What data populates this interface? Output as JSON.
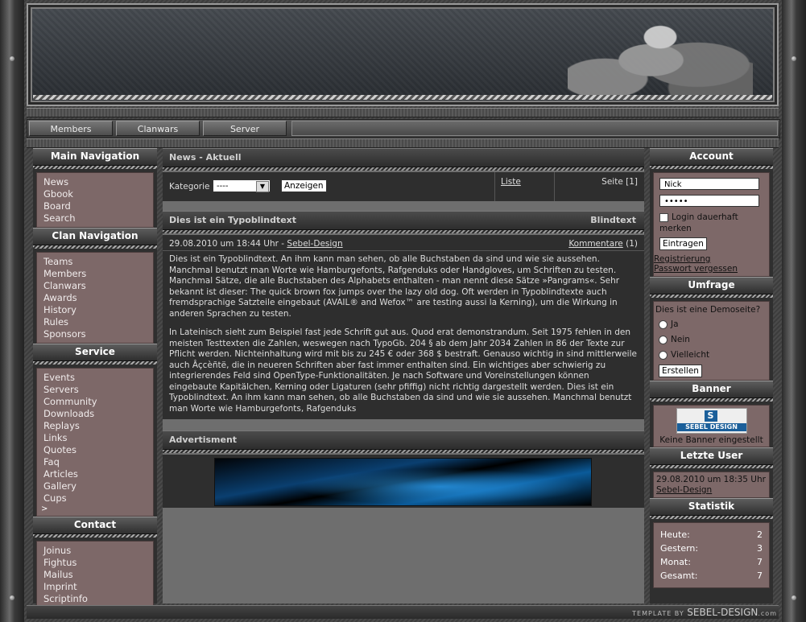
{
  "topnav": [
    "Members",
    "Clanwars",
    "Server"
  ],
  "left": {
    "main_nav": {
      "title": "Main Navigation",
      "items": [
        "News",
        "Gbook",
        "Board",
        "Search"
      ]
    },
    "clan_nav": {
      "title": "Clan Navigation",
      "items": [
        "Teams",
        "Members",
        "Clanwars",
        "Awards",
        "History",
        "Rules",
        "Sponsors"
      ]
    },
    "service": {
      "title": "Service",
      "items": [
        "Events",
        "Servers",
        "Community",
        "Downloads",
        "Replays",
        "Links",
        "Quotes",
        "Faq",
        "Articles",
        "Gallery",
        "Cups"
      ],
      "more": ">"
    },
    "contact": {
      "title": "Contact",
      "items": [
        "Joinus",
        "Fightus",
        "Mailus",
        "Imprint",
        "Scriptinfo"
      ]
    }
  },
  "news": {
    "title": "News - Aktuell",
    "kategorie_label": "Kategorie",
    "select_value": "----",
    "submit": "Anzeigen",
    "liste": "Liste",
    "seite": "Seite [1]"
  },
  "article": {
    "title": "Dies ist ein Typoblindtext",
    "tag": "Blindtext",
    "date": "29.08.2010 um 18:44 Uhr - ",
    "author": "Sebel-Design",
    "comments_label": "Kommentare",
    "comments_count": "(1)",
    "p1": "Dies ist ein Typoblindtext. An ihm kann man sehen, ob alle Buchstaben da sind und wie sie aussehen. Manchmal benutzt man Worte wie Hamburgefonts, Rafgenduks oder Handgloves, um Schriften zu testen. Manchmal Sätze, die alle Buchstaben des Alphabets enthalten - man nennt diese Sätze »Pangrams«. Sehr bekannt ist dieser: The quick brown fox jumps over the lazy old dog. Oft werden in Typoblindtexte auch fremdsprachige Satzteile eingebaut (AVAIL® and Wefox™ are testing aussi la Kerning), um die Wirkung in anderen Sprachen zu testen.",
    "p2": "In Lateinisch sieht zum Beispiel fast jede Schrift gut aus. Quod erat demonstrandum. Seit 1975 fehlen in den meisten Testtexten die Zahlen, weswegen nach TypoGb. 204 § ab dem Jahr 2034 Zahlen in 86 der Texte zur Pflicht werden. Nichteinhaltung wird mit bis zu 245 € oder 368 $ bestraft. Genauso wichtig in sind mittlerweile auch Âçcèñtë, die in neueren Schriften aber fast immer enthalten sind. Ein wichtiges aber schwierig zu integrierendes Feld sind OpenType-Funktionalitäten. Je nach Software und Voreinstellungen können eingebaute Kapitälchen, Kerning oder Ligaturen (sehr pfiffig) nicht richtig dargestellt werden. Dies ist ein Typoblindtext. An ihm kann man sehen, ob alle Buchstaben da sind und wie sie aussehen. Manchmal benutzt man Worte wie Hamburgefonts, Rafgenduks"
  },
  "advert": {
    "title": "Advertisment"
  },
  "account": {
    "title": "Account",
    "username": "Nick",
    "password": "•••••",
    "remember": "Login dauerhaft merken",
    "submit": "Eintragen",
    "register": "Registrierung",
    "forgot": "Passwort vergessen"
  },
  "poll": {
    "title": "Umfrage",
    "question": "Dies ist eine Demoseite?",
    "options": [
      "Ja",
      "Nein",
      "Vielleicht"
    ],
    "submit": "Erstellen"
  },
  "banner": {
    "title": "Banner",
    "logo_text": "SEBEL DESIGN",
    "logo_mark": "S",
    "caption": "Keine Banner eingestellt"
  },
  "last_user": {
    "title": "Letzte User",
    "date": "29.08.2010 um 18:35 Uhr",
    "name": "Sebel-Design"
  },
  "stats": {
    "title": "Statistik",
    "rows": [
      {
        "label": "Heute:",
        "value": "2"
      },
      {
        "label": "Gestern:",
        "value": "3"
      },
      {
        "label": "Monat:",
        "value": "7"
      },
      {
        "label": "Gesamt:",
        "value": "7"
      }
    ]
  },
  "footer": {
    "prefix": "TEMPLATE BY ",
    "brand": "SEBEL-DESIGN",
    "suffix": ".com"
  }
}
